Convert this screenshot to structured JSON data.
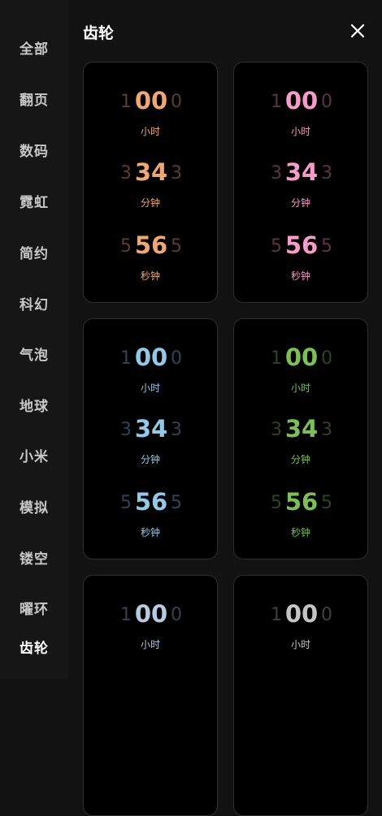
{
  "sidebar": {
    "items": [
      {
        "label": "全部"
      },
      {
        "label": "翻页"
      },
      {
        "label": "数码"
      },
      {
        "label": "霓虹"
      },
      {
        "label": "简约"
      },
      {
        "label": "科幻"
      },
      {
        "label": "气泡"
      },
      {
        "label": "地球"
      },
      {
        "label": "小米"
      },
      {
        "label": "模拟"
      },
      {
        "label": "镂空"
      },
      {
        "label": "曜环"
      },
      {
        "label": "齿轮"
      }
    ],
    "active_label": "齿轮"
  },
  "header": {
    "title": "齿轮",
    "close_icon": "close-icon"
  },
  "cards": [
    {
      "color": "#f0a774",
      "dim": "#5a3d2c",
      "rows": [
        {
          "prev": "1",
          "value": "00",
          "next": "0",
          "label": "小时"
        },
        {
          "prev": "3",
          "value": "34",
          "next": "3",
          "label": "分钟"
        },
        {
          "prev": "5",
          "value": "56",
          "next": "5",
          "label": "秒钟"
        }
      ]
    },
    {
      "color": "#f59cc9",
      "dim": "#5a3444",
      "rows": [
        {
          "prev": "1",
          "value": "00",
          "next": "0",
          "label": "小时"
        },
        {
          "prev": "3",
          "value": "34",
          "next": "3",
          "label": "分钟"
        },
        {
          "prev": "5",
          "value": "56",
          "next": "5",
          "label": "秒钟"
        }
      ]
    },
    {
      "color": "#93c8e6",
      "dim": "#2f4452",
      "rows": [
        {
          "prev": "1",
          "value": "00",
          "next": "0",
          "label": "小时"
        },
        {
          "prev": "3",
          "value": "34",
          "next": "3",
          "label": "分钟"
        },
        {
          "prev": "5",
          "value": "56",
          "next": "5",
          "label": "秒钟"
        }
      ]
    },
    {
      "color": "#7cbf5a",
      "dim": "#2d4424",
      "rows": [
        {
          "prev": "1",
          "value": "00",
          "next": "0",
          "label": "小时"
        },
        {
          "prev": "3",
          "value": "34",
          "next": "3",
          "label": "分钟"
        },
        {
          "prev": "5",
          "value": "56",
          "next": "5",
          "label": "秒钟"
        }
      ]
    },
    {
      "color": "#b4cbe0",
      "dim": "#37414b",
      "rows": [
        {
          "prev": "1",
          "value": "00",
          "next": "0",
          "label": "小时"
        }
      ]
    },
    {
      "color": "#c4c4c4",
      "dim": "#3f3f3f",
      "rows": [
        {
          "prev": "1",
          "value": "00",
          "next": "0",
          "label": "小时"
        }
      ]
    }
  ]
}
